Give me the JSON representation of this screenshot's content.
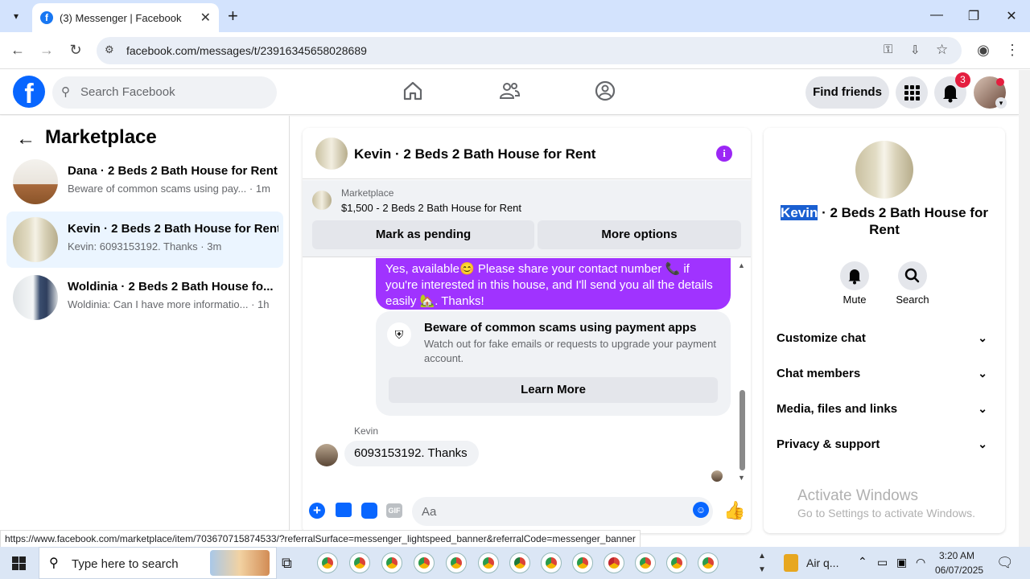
{
  "browser": {
    "tab_title": "(3) Messenger | Facebook",
    "url": "facebook.com/messages/t/23916345658028689",
    "status_url": "https://www.facebook.com/marketplace/item/703670715874533/?referralSurface=messenger_lightspeed_banner&referralCode=messenger_banner"
  },
  "fb_header": {
    "search_placeholder": "Search Facebook",
    "find_friends": "Find friends",
    "notification_count": "3"
  },
  "left": {
    "title": "Marketplace",
    "conversations": [
      {
        "name": "Dana · 2 Beds 2 Bath House for Rent",
        "preview": "Beware of common scams using pay... · 1m",
        "selected": false
      },
      {
        "name": "Kevin · 2 Beds 2 Bath House for Rent",
        "preview": "Kevin: 6093153192. Thanks · 3m",
        "selected": true
      },
      {
        "name": "Woldinia · 2 Beds 2 Bath House fo...",
        "preview": "Woldinia: Can I have more informatio... · 1h",
        "selected": false
      }
    ]
  },
  "chat": {
    "title": "Kevin · 2 Beds 2 Bath House for Rent",
    "banner_label": "Marketplace",
    "banner_listing": "$1,500 - 2 Beds 2 Bath House for Rent",
    "mark_pending": "Mark as pending",
    "more_options": "More options",
    "sent_message": "Yes, available😊 Please share your contact number 📞 if you're interested in this house, and I'll send you all the details easily 🏡. Thanks!",
    "scam_title": "Beware of common scams using payment apps",
    "scam_body": "Watch out for fake emails or requests to upgrade your payment account.",
    "learn_more": "Learn More",
    "sender_name": "Kevin",
    "received_message": "6093153192.   Thanks",
    "composer_placeholder": "Aa"
  },
  "right": {
    "name_highlight": "Kevin",
    "name_rest": " · 2 Beds 2 Bath House for Rent",
    "mute": "Mute",
    "search": "Search",
    "sections": [
      "Customize chat",
      "Chat members",
      "Media, files and links",
      "Privacy & support"
    ],
    "watermark_title": "Activate Windows",
    "watermark_sub": "Go to Settings to activate Windows."
  },
  "taskbar": {
    "search_placeholder": "Type here to search",
    "weather": "Air q...",
    "time": "3:20 AM",
    "date": "06/07/2025"
  },
  "colors": {
    "fb_blue": "#0866ff",
    "bubble_purple": "#a033ff",
    "info_purple": "#9b27f5",
    "selected_bg": "#ebf5ff"
  }
}
